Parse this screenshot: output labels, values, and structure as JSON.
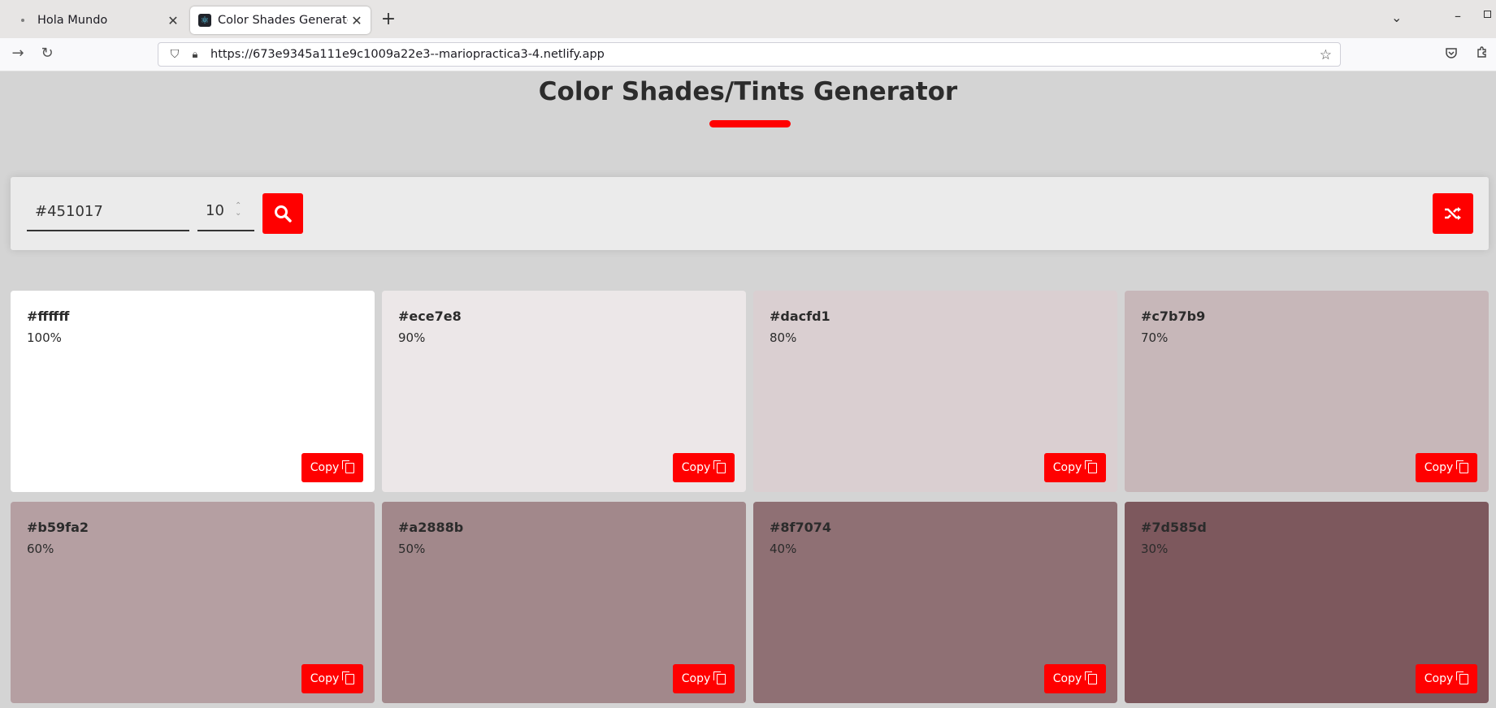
{
  "browser": {
    "tabs": [
      {
        "title": "Hola Mundo",
        "active": false
      },
      {
        "title": "Color Shades Generator",
        "active": true
      }
    ],
    "url_domain_part": "https://673e9345a111e9c1009a22e3--mariopractica3-4.",
    "url_tld": "netlify.app"
  },
  "header": {
    "title": "Color Shades/Tints Generator"
  },
  "controls": {
    "color_value": "#451017",
    "count_value": "10"
  },
  "cards": [
    {
      "hex": "#ffffff",
      "percent": "100%",
      "bg": "#ffffff",
      "copy": "Copy"
    },
    {
      "hex": "#ece7e8",
      "percent": "90%",
      "bg": "#ece7e8",
      "copy": "Copy"
    },
    {
      "hex": "#dacfd1",
      "percent": "80%",
      "bg": "#dacfd1",
      "copy": "Copy"
    },
    {
      "hex": "#c7b7b9",
      "percent": "70%",
      "bg": "#c7b7b9",
      "copy": "Copy"
    },
    {
      "hex": "#b59fa2",
      "percent": "60%",
      "bg": "#b59fa2",
      "copy": "Copy"
    },
    {
      "hex": "#a2888b",
      "percent": "50%",
      "bg": "#a2888b",
      "copy": "Copy"
    },
    {
      "hex": "#8f7074",
      "percent": "40%",
      "bg": "#8f7074",
      "copy": "Copy"
    },
    {
      "hex": "#7d585d",
      "percent": "30%",
      "bg": "#7d585d",
      "copy": "Copy"
    }
  ],
  "colors": {
    "accent": "#ff0000",
    "page_bg": "#d4d4d4",
    "panel_bg": "#ebebeb"
  }
}
